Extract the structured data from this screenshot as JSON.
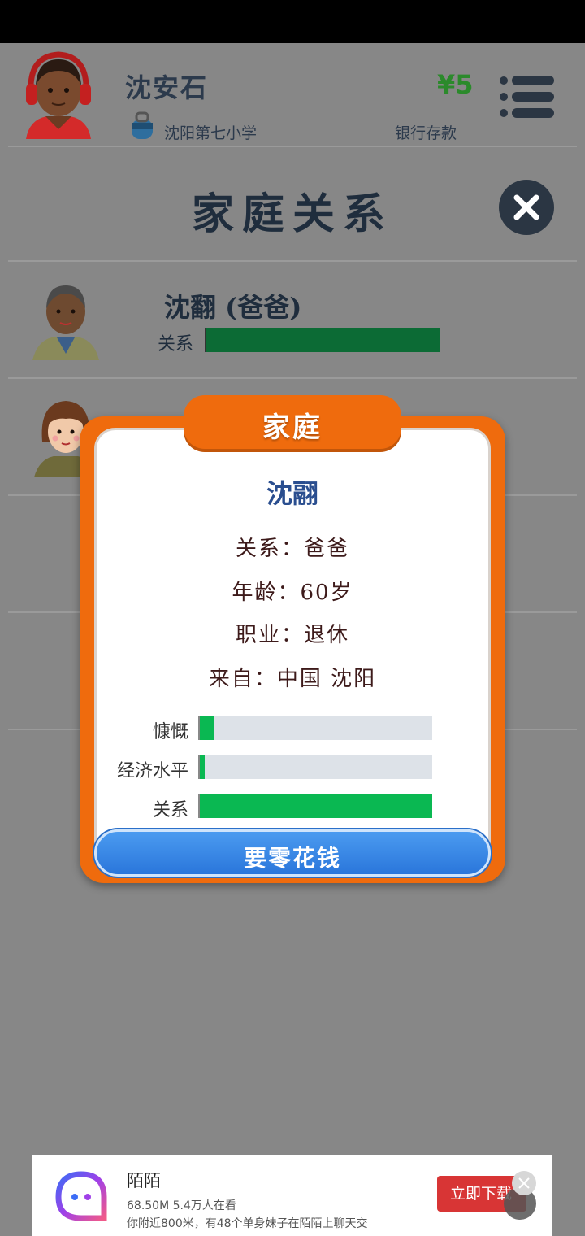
{
  "header": {
    "player_name": "沈安石",
    "school": "沈阳第七小学",
    "money": "¥5",
    "bank_label": "银行存款"
  },
  "page": {
    "title": "家庭关系"
  },
  "members": [
    {
      "name": "沈翻 (爸爸)",
      "relation_label": "关系",
      "relation_level": 1.0
    }
  ],
  "modal": {
    "tab_title": "家庭",
    "name": "沈翮",
    "relation_line": "关系：爸爸",
    "age_line": "年龄：60岁",
    "job_line": "职业：退休",
    "from_line": "来自：中国 沈阳",
    "stats": [
      {
        "label": "慷慨",
        "value": 0.06
      },
      {
        "label": "经济水平",
        "value": 0.02
      },
      {
        "label": "关系",
        "value": 1.0
      }
    ],
    "button_label": "要零花钱"
  },
  "ad": {
    "title": "陌陌",
    "subtitle": "68.50M 5.4万人在看",
    "description": "你附近800米，有48个单身妹子在陌陌上聊天交",
    "button_label": "立即下载"
  },
  "colors": {
    "accent_orange": "#ef6b0d",
    "bar_green": "#0ab852",
    "button_blue": "#2a76db"
  }
}
